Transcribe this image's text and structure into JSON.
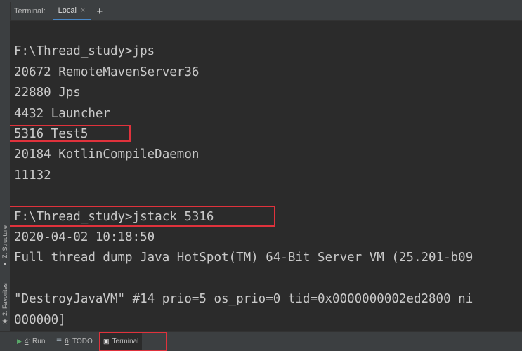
{
  "tabbar": {
    "title": "Terminal:",
    "active_tab": "Local",
    "close_glyph": "×",
    "add_glyph": "+"
  },
  "sidebar": {
    "structure": {
      "label": "Z: Structure",
      "icon": "structure-icon"
    },
    "favorites": {
      "label": "2: Favorites",
      "icon": "star-icon"
    }
  },
  "terminal": {
    "lines": [
      "F:\\Thread_study>jps",
      "20672 RemoteMavenServer36",
      "22880 Jps",
      "4432 Launcher",
      "5316 Test5",
      "20184 KotlinCompileDaemon",
      "11132",
      "",
      "F:\\Thread_study>jstack 5316",
      "2020-04-02 10:18:50",
      "Full thread dump Java HotSpot(TM) 64-Bit Server VM (25.201-b09",
      "",
      "\"DestroyJavaVM\" #14 prio=5 os_prio=0 tid=0x0000000002ed2800 ni",
      "000000]"
    ],
    "highlight_color": "#e0323c"
  },
  "bottombar": {
    "run": {
      "key": "4",
      "label": ": Run",
      "icon": "run-icon"
    },
    "todo": {
      "key": "6",
      "label": ": TODO",
      "icon": "todo-icon"
    },
    "terminal": {
      "label": "Terminal",
      "icon": "terminal-icon"
    }
  }
}
